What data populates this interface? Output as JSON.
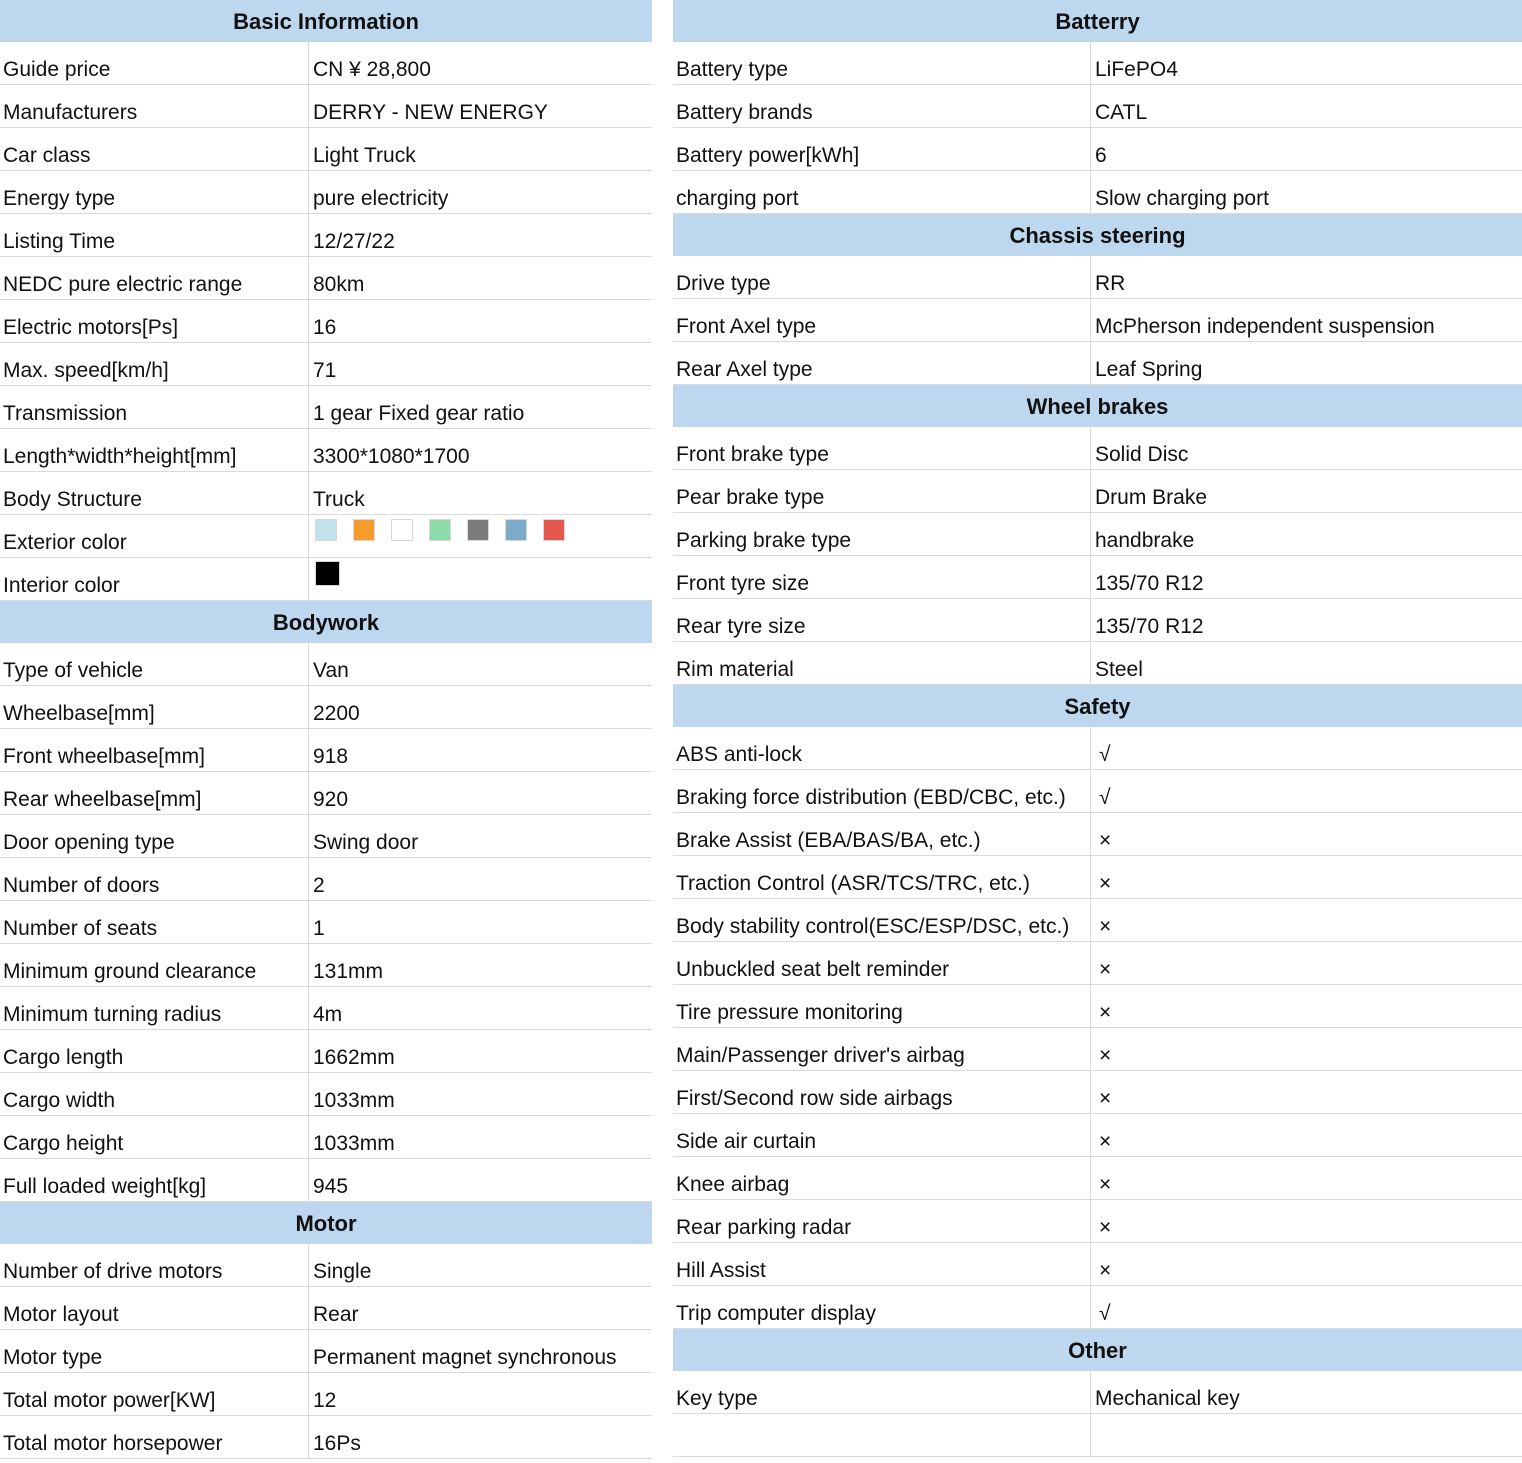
{
  "left": {
    "sections": [
      {
        "title": "Basic Information",
        "rows": [
          {
            "label": "Guide price",
            "value": "CN ¥ 28,800"
          },
          {
            "label": "Manufacturers",
            "value": "DERRY - NEW ENERGY"
          },
          {
            "label": "Car class",
            "value": "Light Truck"
          },
          {
            "label": "Energy type",
            "value": "pure electricity"
          },
          {
            "label": "Listing Time",
            "value": "12/27/22"
          },
          {
            "label": "NEDC pure electric range",
            "value": "80km"
          },
          {
            "label": "Electric motors[Ps]",
            "value": "16"
          },
          {
            "label": "Max. speed[km/h]",
            "value": "71"
          },
          {
            "label": "Transmission",
            "value": "1 gear Fixed gear ratio"
          },
          {
            "label": "Length*width*height[mm]",
            "value": "3300*1080*1700"
          },
          {
            "label": "Body Structure",
            "value": "Truck"
          },
          {
            "label": "Exterior color",
            "colors": [
              "#bfe2ec",
              "#f59c2f",
              "#ffffff",
              "#8ddba8",
              "#7b7b7b",
              "#7fabcb",
              "#e5584d"
            ]
          },
          {
            "label": "Interior color",
            "colors": [
              "#000000"
            ]
          }
        ]
      },
      {
        "title": "Bodywork",
        "rows": [
          {
            "label": "Type of vehicle",
            "value": "Van"
          },
          {
            "label": "Wheelbase[mm]",
            "value": "2200"
          },
          {
            "label": "Front wheelbase[mm]",
            "value": "918"
          },
          {
            "label": "Rear wheelbase[mm]",
            "value": "920"
          },
          {
            "label": "Door opening type",
            "value": "Swing door"
          },
          {
            "label": "Number of doors",
            "value": "2"
          },
          {
            "label": "Number of seats",
            "value": "1"
          },
          {
            "label": "Minimum ground clearance",
            "value": "131mm"
          },
          {
            "label": "Minimum turning radius",
            "value": "4m"
          },
          {
            "label": "Cargo length",
            "value": "1662mm"
          },
          {
            "label": "Cargo width",
            "value": "1033mm"
          },
          {
            "label": "Cargo height",
            "value": "1033mm"
          },
          {
            "label": "Full loaded weight[kg]",
            "value": "945"
          }
        ]
      },
      {
        "title": "Motor",
        "rows": [
          {
            "label": "Number of drive motors",
            "value": "Single"
          },
          {
            "label": "Motor layout",
            "value": "Rear"
          },
          {
            "label": "Motor type",
            "value": "Permanent magnet synchronous"
          },
          {
            "label": "Total motor power[KW]",
            "value": "12"
          },
          {
            "label": "Total motor horsepower",
            "value": "16Ps"
          }
        ]
      }
    ]
  },
  "right": {
    "sections": [
      {
        "title": "Batterry",
        "rows": [
          {
            "label": "Battery type",
            "value": "LiFePO4"
          },
          {
            "label": "Battery brands",
            "value": "CATL"
          },
          {
            "label": "Battery power[kWh]",
            "value": "6"
          },
          {
            "label": "charging port",
            "value": "Slow charging port"
          }
        ]
      },
      {
        "title": "Chassis steering",
        "rows": [
          {
            "label": "Drive type",
            "value": "RR"
          },
          {
            "label": "Front Axel type",
            "value": "McPherson independent suspension"
          },
          {
            "label": "Rear Axel type",
            "value": "Leaf Spring"
          }
        ]
      },
      {
        "title": "Wheel brakes",
        "rows": [
          {
            "label": "Front brake type",
            "value": "Solid Disc"
          },
          {
            "label": "Pear brake type",
            "value": "Drum Brake"
          },
          {
            "label": "Parking brake type",
            "value": "handbrake"
          },
          {
            "label": "Front tyre size",
            "value": "135/70 R12"
          },
          {
            "label": "Rear tyre size",
            "value": "135/70 R12"
          },
          {
            "label": "Rim material",
            "value": "Steel"
          }
        ]
      },
      {
        "title": "Safety",
        "rows": [
          {
            "label": "ABS anti-lock",
            "value": "√",
            "mark": true
          },
          {
            "label": "Braking force distribution (EBD/CBC, etc.)",
            "value": "√",
            "mark": true
          },
          {
            "label": "Brake Assist (EBA/BAS/BA, etc.)",
            "value": "×",
            "mark": true
          },
          {
            "label": "Traction Control (ASR/TCS/TRC, etc.)",
            "value": "×",
            "mark": true
          },
          {
            "label": "Body stability control(ESC/ESP/DSC, etc.)",
            "value": "×",
            "mark": true
          },
          {
            "label": "Unbuckled seat belt reminder",
            "value": "×",
            "mark": true
          },
          {
            "label": "Tire pressure monitoring",
            "value": "×",
            "mark": true
          },
          {
            "label": "Main/Passenger driver's airbag",
            "value": "×",
            "mark": true
          },
          {
            "label": "First/Second row side airbags",
            "value": "×",
            "mark": true
          },
          {
            "label": "Side air curtain",
            "value": "×",
            "mark": true
          },
          {
            "label": "Knee airbag",
            "value": "×",
            "mark": true
          },
          {
            "label": "Rear parking radar",
            "value": "×",
            "mark": true
          },
          {
            "label": "Hill Assist",
            "value": "×",
            "mark": true
          },
          {
            "label": "Trip computer display",
            "value": "√",
            "mark": true
          }
        ]
      },
      {
        "title": "Other",
        "rows": [
          {
            "label": "Key type",
            "value": "Mechanical key"
          },
          {
            "label": "",
            "value": ""
          }
        ]
      }
    ]
  }
}
